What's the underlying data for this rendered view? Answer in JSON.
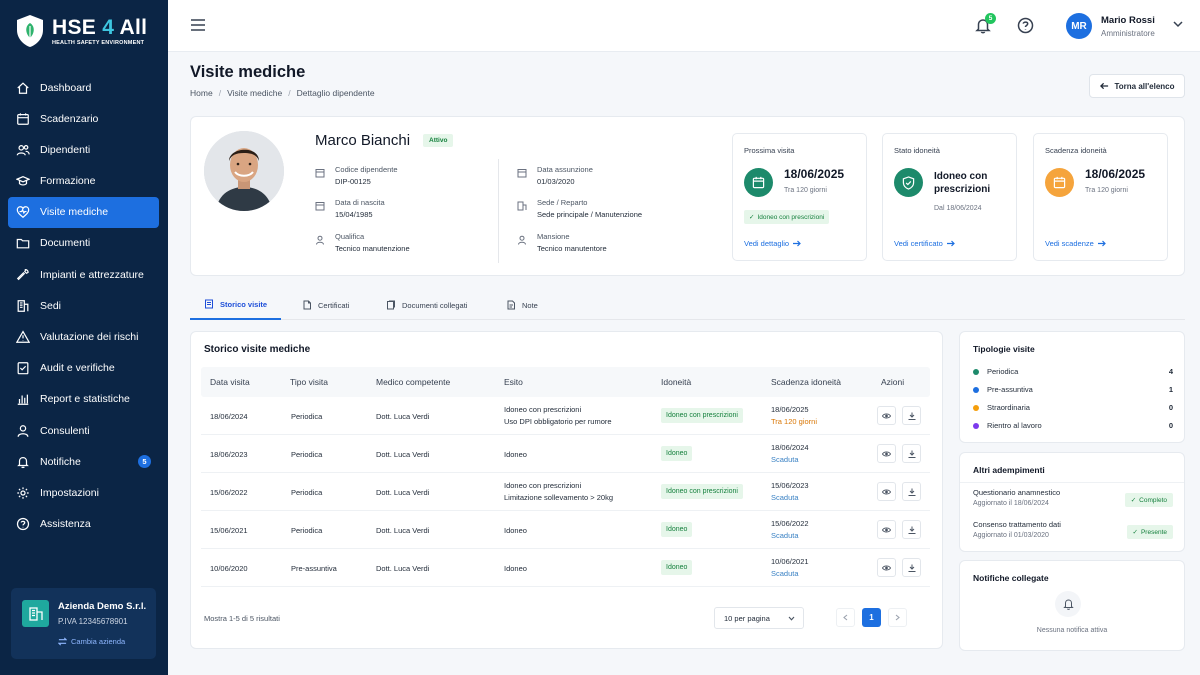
{
  "app": {
    "logo_title_a": "HSE ",
    "logo_title_b": "4",
    "logo_title_c": " All",
    "logo_subtitle": "HEALTH SAFETY ENVIRONMENT"
  },
  "sidebar": {
    "items": [
      {
        "label": "Dashboard",
        "icon": "home-icon"
      },
      {
        "label": "Scadenzario",
        "icon": "calendar-icon"
      },
      {
        "label": "Dipendenti",
        "icon": "users-icon"
      },
      {
        "label": "Formazione",
        "icon": "graduation-cap-icon"
      },
      {
        "label": "Visite mediche",
        "icon": "heart-shield-icon"
      },
      {
        "label": "Documenti",
        "icon": "folder-icon"
      },
      {
        "label": "Impianti e attrezzature",
        "icon": "wrench-icon"
      },
      {
        "label": "Sedi",
        "icon": "building-icon"
      },
      {
        "label": "Valutazione dei rischi",
        "icon": "warning-icon"
      },
      {
        "label": "Audit e verifiche",
        "icon": "checklist-icon"
      },
      {
        "label": "Report e statistiche",
        "icon": "bar-chart-icon"
      },
      {
        "label": "Consulenti",
        "icon": "user-icon"
      },
      {
        "label": "Notifiche",
        "icon": "bell-icon",
        "badge": "5"
      },
      {
        "label": "Impostazioni",
        "icon": "gear-icon"
      },
      {
        "label": "Assistenza",
        "icon": "help-icon"
      }
    ],
    "active_index": 4,
    "company": {
      "name": "Azienda Demo S.r.l.",
      "vat": "P.IVA 12345678901",
      "switch_label": "Cambia azienda"
    }
  },
  "topbar": {
    "notification_count": "5",
    "user_initials": "MR",
    "user_name": "Mario Rossi",
    "user_role": "Amministratore"
  },
  "page": {
    "title": "Visite mediche",
    "breadcrumb": [
      "Home",
      "Visite mediche",
      "Dettaglio dipendente"
    ],
    "back_label": "Torna all'elenco"
  },
  "employee": {
    "name": "Marco Bianchi",
    "status": "Attivo",
    "fields": {
      "code_label": "Codice dipendente",
      "code": "DIP-00125",
      "birth_label": "Data di nascita",
      "birth": "15/04/1985",
      "qual_label": "Qualifica",
      "qual": "Tecnico manutenzione",
      "hire_label": "Data assunzione",
      "hire": "01/03/2020",
      "site_label": "Sede / Reparto",
      "site": "Sede principale / Manutenzione",
      "role_label": "Mansione",
      "role": "Tecnico manutentore"
    }
  },
  "kpis": {
    "next": {
      "title": "Prossima visita",
      "date": "18/06/2025",
      "sub": "Tra 120 giorni",
      "pill": "Idoneo con prescrizioni",
      "link": "Vedi dettaglio"
    },
    "fitness": {
      "title": "Stato idoneità",
      "main_1": "Idoneo con",
      "main_2": "prescrizioni",
      "sub": "Dal 18/06/2024",
      "link": "Vedi certificato"
    },
    "expiry": {
      "title": "Scadenza idoneità",
      "date": "18/06/2025",
      "sub": "Tra 120 giorni",
      "link": "Vedi scadenze"
    }
  },
  "tabs": [
    "Storico visite",
    "Certificati",
    "Documenti collegati",
    "Note"
  ],
  "history": {
    "title": "Storico visite mediche",
    "columns": [
      "Data visita",
      "Tipo visita",
      "Medico competente",
      "Esito",
      "Idoneità",
      "Scadenza idoneità",
      "Azioni"
    ],
    "rows": [
      {
        "date": "18/06/2024",
        "type": "Periodica",
        "doctor": "Dott. Luca Verdi",
        "outcome": "Idoneo con prescrizioni",
        "outcome_note": "Uso DPI obbligatorio per rumore",
        "fitness": "Idoneo con prescrizioni",
        "expiry": "18/06/2025",
        "expiry_note": "Tra 120 giorni"
      },
      {
        "date": "18/06/2023",
        "type": "Periodica",
        "doctor": "Dott. Luca Verdi",
        "outcome": "Idoneo",
        "outcome_note": "",
        "fitness": "Idoneo",
        "expiry": "18/06/2024",
        "expiry_note": "Scaduta"
      },
      {
        "date": "15/06/2022",
        "type": "Periodica",
        "doctor": "Dott. Luca Verdi",
        "outcome": "Idoneo con prescrizioni",
        "outcome_note": "Limitazione sollevamento > 20kg",
        "fitness": "Idoneo con prescrizioni",
        "expiry": "15/06/2023",
        "expiry_note": "Scaduta"
      },
      {
        "date": "15/06/2021",
        "type": "Periodica",
        "doctor": "Dott. Luca Verdi",
        "outcome": "Idoneo",
        "outcome_note": "",
        "fitness": "Idoneo",
        "expiry": "15/06/2022",
        "expiry_note": "Scaduta"
      },
      {
        "date": "10/06/2020",
        "type": "Pre-assuntiva",
        "doctor": "Dott. Luca Verdi",
        "outcome": "Idoneo",
        "outcome_note": "",
        "fitness": "Idoneo",
        "expiry": "10/06/2021",
        "expiry_note": "Scaduta"
      }
    ],
    "footer": "Mostra 1-5 di 5 risultati",
    "per_page": "10 per pagina",
    "current_page": "1"
  },
  "visit_types": {
    "title": "Tipologie visite",
    "items": [
      {
        "label": "Periodica",
        "count": "4",
        "color": "#1d8a6b"
      },
      {
        "label": "Pre-assuntiva",
        "count": "1",
        "color": "#1d6fe0"
      },
      {
        "label": "Straordinaria",
        "count": "0",
        "color": "#f59e0b"
      },
      {
        "label": "Rientro al lavoro",
        "count": "0",
        "color": "#7c3aed"
      }
    ]
  },
  "other_duties": {
    "title": "Altri adempimenti",
    "items": [
      {
        "title": "Questionario anamnestico",
        "sub": "Aggiornato il 18/06/2024",
        "status": "Completo"
      },
      {
        "title": "Consenso trattamento dati",
        "sub": "Aggiornato il 01/03/2020",
        "status": "Presente"
      }
    ]
  },
  "linked_notifications": {
    "title": "Notifiche collegate",
    "empty": "Nessuna notifica attiva"
  }
}
